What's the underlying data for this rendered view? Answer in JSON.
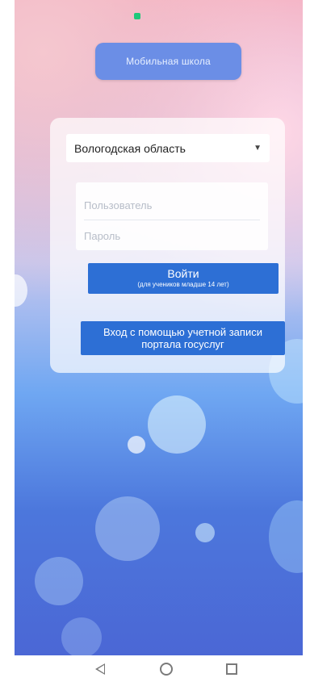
{
  "header": {
    "logo_text": "Мобильная школа"
  },
  "form": {
    "region": "Вологодская область",
    "username_placeholder": "Пользователь",
    "password_placeholder": "Пароль",
    "login_button": "Войти",
    "login_note": "(для учеников младше 14 лет)",
    "gosuslugi_button": "Вход с помощью учетной записи портала госуслуг"
  },
  "colors": {
    "primary_button": "#2d6fd5",
    "logo_background": "#6b8ee6",
    "status_indicator": "#1ec87a"
  },
  "navigation": {
    "back_icon": "back-triangle-icon",
    "home_icon": "home-circle-icon",
    "recent_icon": "recent-apps-square-icon"
  }
}
